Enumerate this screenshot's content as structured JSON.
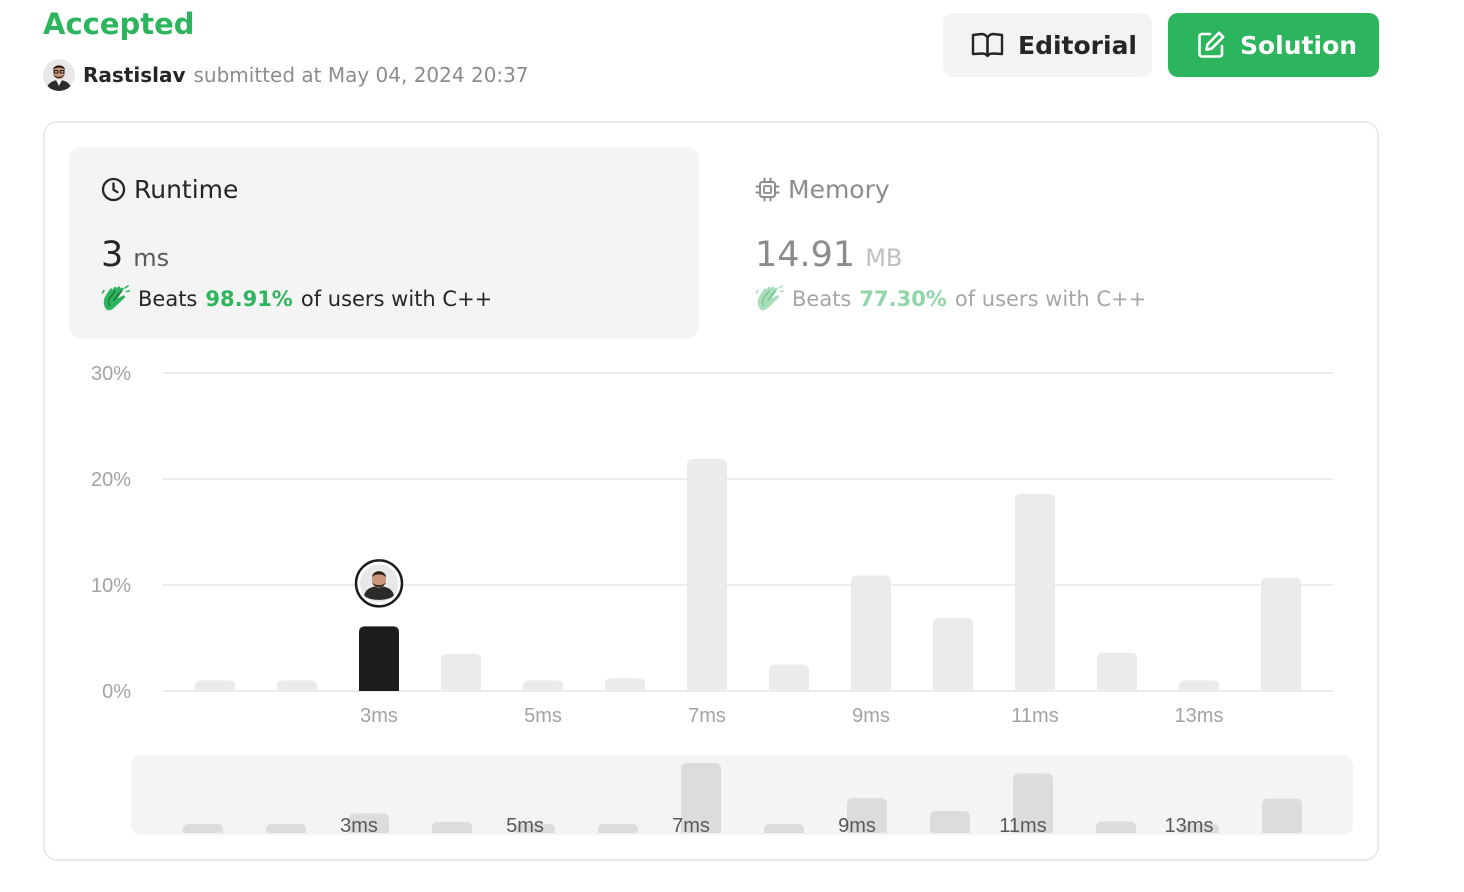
{
  "header": {
    "status": "Accepted",
    "author": "Rastislav",
    "submitted_text": "submitted at May 04, 2024 20:37",
    "editorial_label": "Editorial",
    "solution_label": "Solution",
    "avatar_icon": "user-avatar",
    "editorial_icon": "book-open-icon",
    "solution_icon": "edit-pencil-icon"
  },
  "runtime": {
    "title": "Runtime",
    "value": "3",
    "unit": "ms",
    "beats_prefix": "Beats",
    "beats_pct": "98.91%",
    "beats_suffix": "of users with C++",
    "icon": "clock-icon"
  },
  "memory": {
    "title": "Memory",
    "value": "14.91",
    "unit": "MB",
    "beats_prefix": "Beats",
    "beats_pct": "77.30%",
    "beats_suffix": "of users with C++",
    "icon": "chip-icon"
  },
  "colors": {
    "accent": "#2db55d",
    "bar": "#ebebeb",
    "bar_selected": "#1c1c1c",
    "nav_bar": "#dcdcdc",
    "nav_bg": "#f4f4f4"
  },
  "chart_data": {
    "type": "bar",
    "title": "",
    "xlabel": "",
    "ylabel": "",
    "categories": [
      "1ms",
      "2ms",
      "3ms",
      "4ms",
      "5ms",
      "6ms",
      "7ms",
      "8ms",
      "9ms",
      "10ms",
      "11ms",
      "12ms",
      "13ms",
      "14ms"
    ],
    "tick_labels": [
      "3ms",
      "5ms",
      "7ms",
      "9ms",
      "11ms",
      "13ms"
    ],
    "tick_categories": [
      "3ms",
      "5ms",
      "7ms",
      "9ms",
      "11ms",
      "13ms"
    ],
    "values": [
      1.0,
      1.0,
      6.1,
      3.5,
      1.0,
      1.2,
      21.9,
      2.5,
      10.9,
      6.9,
      18.6,
      3.6,
      1.0,
      10.7
    ],
    "yticks": [
      "0%",
      "10%",
      "20%",
      "30%"
    ],
    "ytick_values": [
      0,
      10,
      20,
      30
    ],
    "ylim": [
      0,
      30
    ],
    "grid": true,
    "selected": "3ms",
    "navigator_labels": [
      "3ms",
      "5ms",
      "7ms",
      "9ms",
      "11ms",
      "13ms"
    ]
  }
}
